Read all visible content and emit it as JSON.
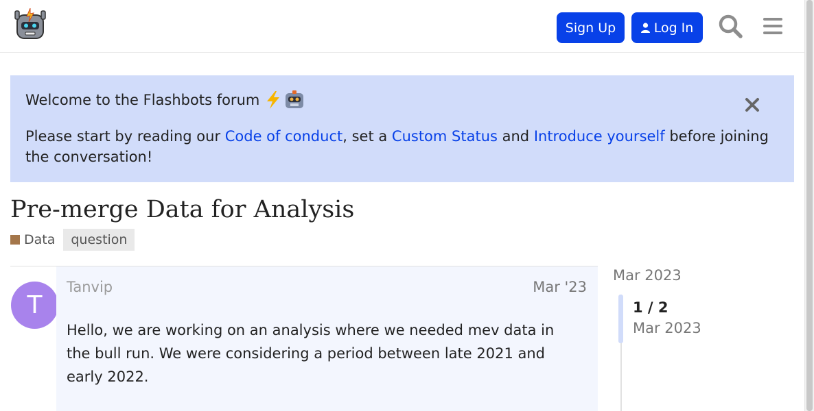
{
  "header": {
    "signup_label": "Sign Up",
    "login_label": "Log In",
    "icons": [
      "robot-logo",
      "user-icon",
      "search-icon",
      "hamburger-menu-icon"
    ]
  },
  "banner": {
    "title": "Welcome to the Flashbots forum",
    "text_before": "Please start by reading our ",
    "link1": "Code of conduct",
    "text_mid1": ", set a ",
    "link2": "Custom Status",
    "text_mid2": " and ",
    "link3": "Introduce yourself",
    "text_after": " before joining the conversation!",
    "bg_color": "#d1dcfa",
    "link_color": "#0841e8"
  },
  "topic": {
    "title": "Pre-merge Data for Analysis",
    "category": "Data",
    "category_color": "#a4764a",
    "tag": "question"
  },
  "post": {
    "avatar_letter": "T",
    "avatar_color": "#a883ec",
    "username": "Tanvip",
    "date": "Mar '23",
    "body": "Hello, we are working on an analysis where we needed mev data in the bull run. We were considering a period between late 2021 and early 2022."
  },
  "timeline": {
    "top_date": "Mar 2023",
    "count": "1 / 2",
    "current_date": "Mar 2023"
  },
  "colors": {
    "accent": "#0841e8"
  }
}
